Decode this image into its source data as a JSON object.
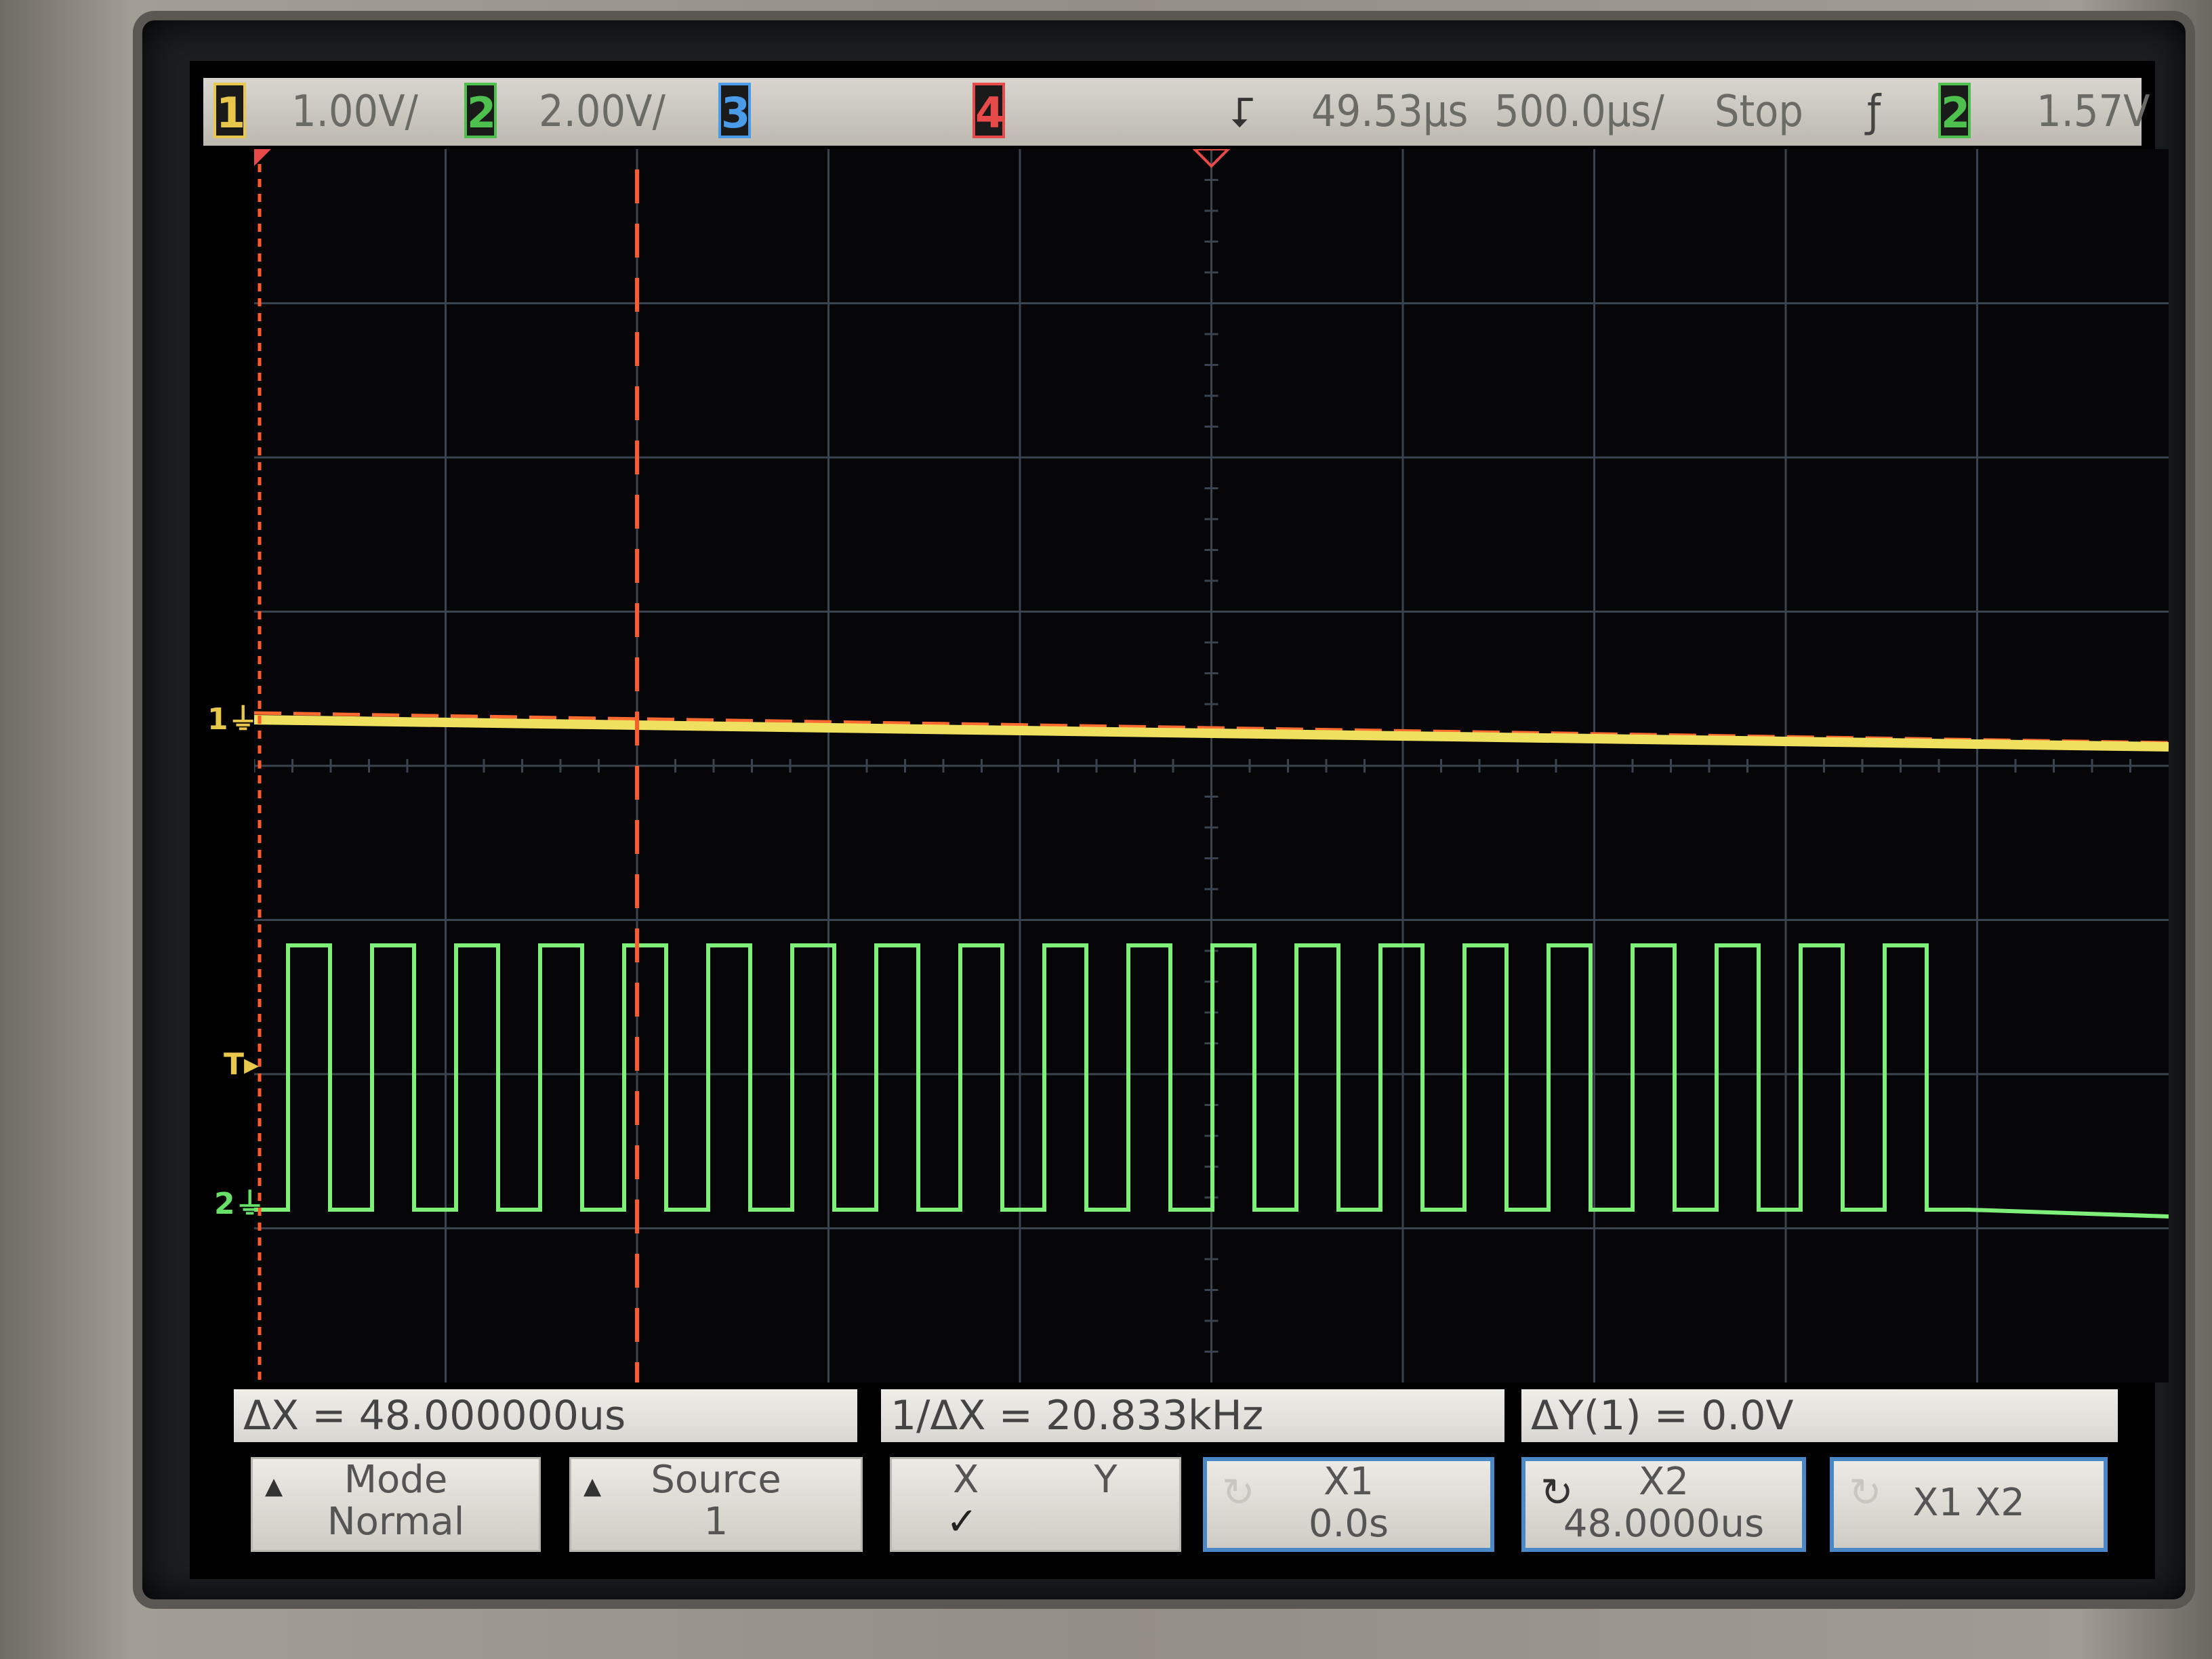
{
  "status": {
    "ch1": {
      "label": "1",
      "scale": "1.00V/",
      "color": "#e8c84a"
    },
    "ch2": {
      "label": "2",
      "scale": "2.00V/",
      "color": "#66e066"
    },
    "ch3": {
      "label": "3",
      "color": "#4a9be8"
    },
    "ch4": {
      "label": "4",
      "color": "#e84a4a"
    },
    "delay": "49.53µs",
    "timebase": "500.0µs/",
    "run_state": "Stop",
    "trigger_slope_icon": "rising-edge-icon",
    "trigger_source": "2",
    "trigger_level": "1.57V"
  },
  "markers": {
    "ch1": "1",
    "trigger": "T",
    "ch2": "2"
  },
  "readouts": {
    "delta_x": "ΔX = 48.000000us",
    "inv_delta_x": "1/ΔX = 20.833kHz",
    "delta_y": "ΔY(1) = 0.0V"
  },
  "softkeys": {
    "mode": {
      "title": "Mode",
      "value": "Normal"
    },
    "source": {
      "title": "Source",
      "value": "1"
    },
    "xy": {
      "x": "X",
      "y": "Y",
      "check": "✓"
    },
    "x1": {
      "title": "X1",
      "value": "0.0s"
    },
    "x2": {
      "title": "X2",
      "value": "48.0000us"
    },
    "x1x2": {
      "title": "X1 X2"
    }
  },
  "waveform": {
    "ch2_pulses": 20,
    "cursor_x1_us": 0,
    "cursor_x2_us": 48
  },
  "colors": {
    "ch1_trace": "#f0e060",
    "ch2_trace": "#7ef07a",
    "cursor": "#ff5a2a",
    "grid": "#3a4450"
  }
}
